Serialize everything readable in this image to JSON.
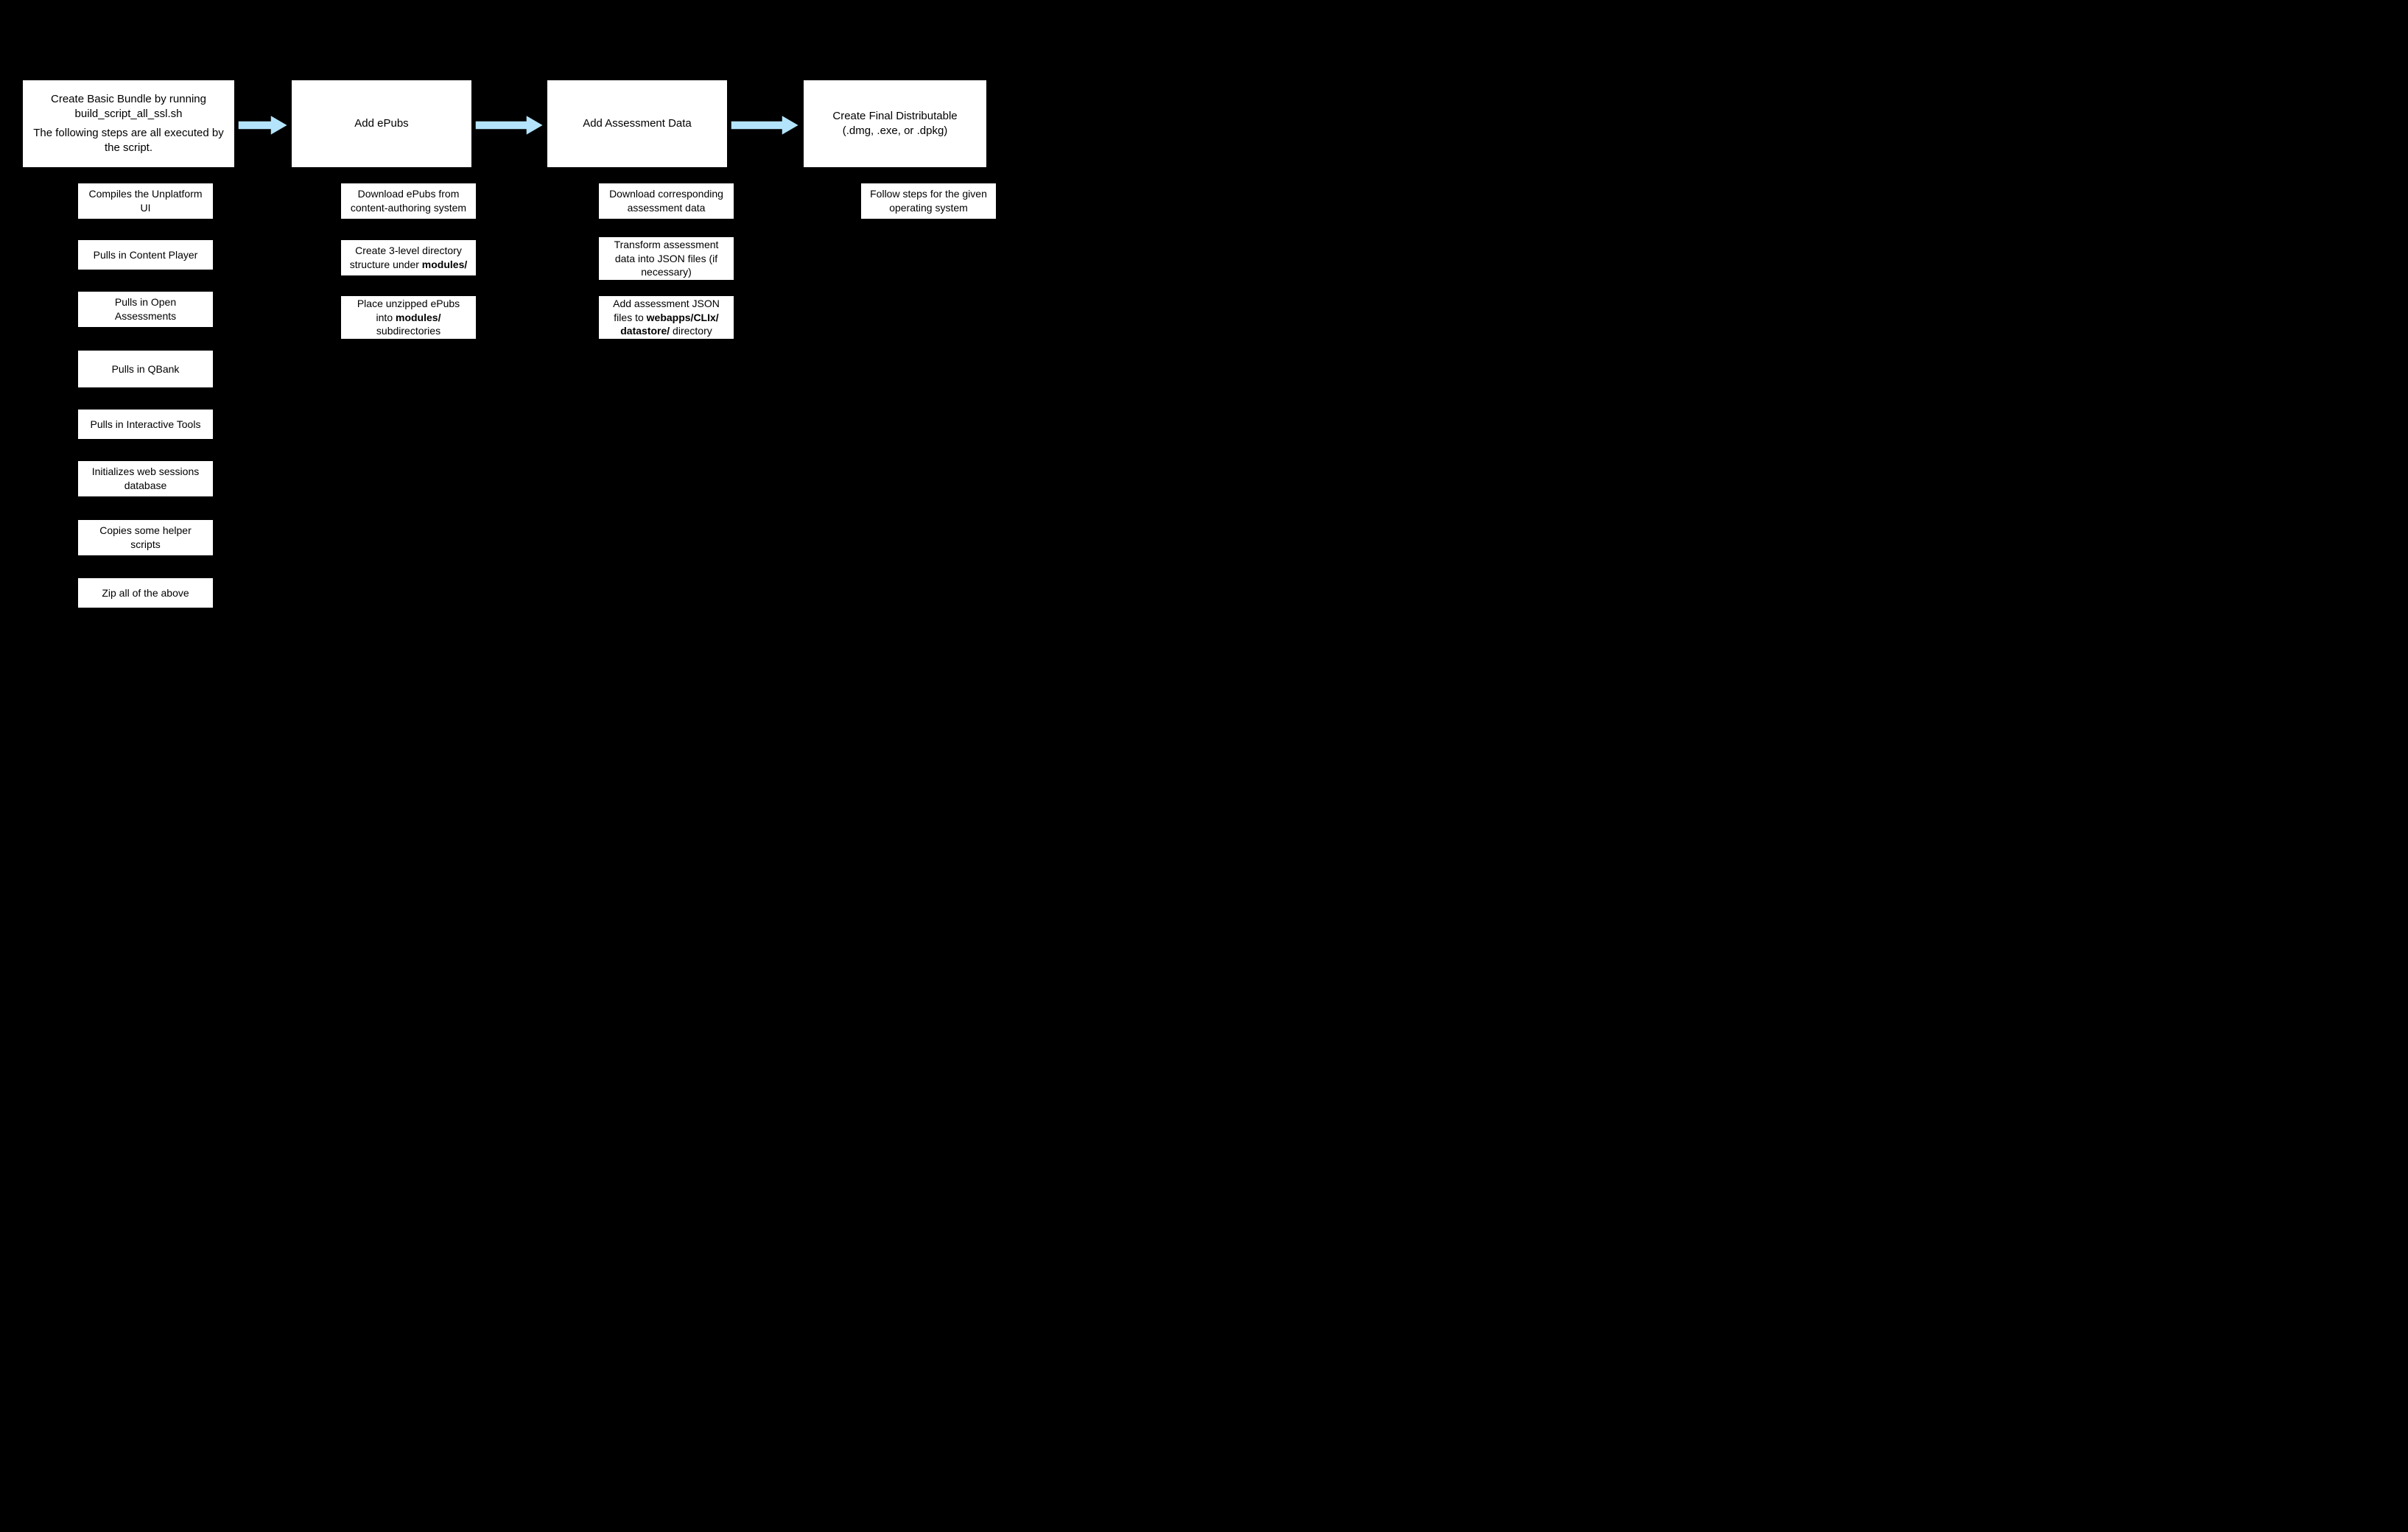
{
  "col1": {
    "main_line1": "Create Basic Bundle by running",
    "main_line2": "build_script_all_ssl.sh",
    "main_line3": "The following steps are all executed by",
    "main_line4": "the script.",
    "subs": [
      {
        "l1": "Compiles the Unplatform",
        "l2": "UI"
      },
      {
        "l1": "Pulls in Content Player"
      },
      {
        "l1": "Pulls in Open",
        "l2": "Assessments"
      },
      {
        "l1": "Pulls in QBank"
      },
      {
        "l1": "Pulls in Interactive Tools"
      },
      {
        "l1": "Initializes web sessions",
        "l2": "database"
      },
      {
        "l1": "Copies some helper",
        "l2": "scripts"
      },
      {
        "l1": "Zip all of the above"
      }
    ]
  },
  "col2": {
    "main": "Add ePubs",
    "subs": [
      {
        "l1": "Download ePubs from",
        "l2": "content-authoring system"
      },
      {
        "pre": "Create 3-level directory",
        "mid": "structure under ",
        "bold": "modules/"
      },
      {
        "pre": "Place unzipped ePubs",
        "mid": "into ",
        "bold": "modules/",
        "post_l": "subdirectories"
      }
    ]
  },
  "col3": {
    "main": "Add Assessment Data",
    "subs": [
      {
        "l1": "Download corresponding",
        "l2": "assessment data"
      },
      {
        "l1": "Transform assessment",
        "l2": "data into JSON files (if",
        "l3": "necessary)"
      },
      {
        "pre": "Add assessment JSON",
        "mid": "files to ",
        "bold": "webapps/CLIx/",
        "bold2": "datastore/",
        "post": " directory"
      }
    ]
  },
  "col4": {
    "main_l1": "Create Final Distributable",
    "main_l2": "(.dmg, .exe, or .dpkg)",
    "subs": [
      {
        "l1": "Follow steps for the given",
        "l2": "operating system"
      }
    ]
  },
  "arrow_fill": "#B3E4FB",
  "arrow_stroke": "#000"
}
